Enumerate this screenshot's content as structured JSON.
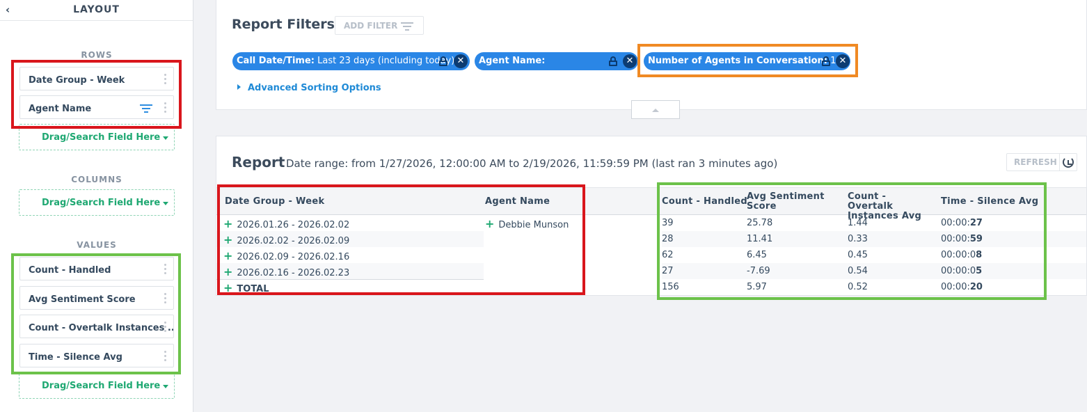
{
  "sidebar": {
    "title": "LAYOUT",
    "rows_label": "ROWS",
    "rows": [
      "Date Group - Week",
      "Agent Name"
    ],
    "columns_label": "COLUMNS",
    "values_label": "VALUES",
    "values": [
      "Count - Handled",
      "Avg Sentiment Score",
      "Count - Overtalk Instances ...",
      "Time - Silence Avg"
    ],
    "drop_label": "Drag/Search Field Here"
  },
  "filters": {
    "title": "Report Filters",
    "add_filter": "ADD FILTER",
    "chips": [
      {
        "label": "Call Date/Time:",
        "value": " Last 23 days (including today)"
      },
      {
        "label": "Agent Name:",
        "value": ""
      },
      {
        "label": "Number of Agents in Conversation:",
        "value": " 1"
      }
    ],
    "advanced": "Advanced Sorting Options"
  },
  "report": {
    "title": "Report",
    "range": "Date range: from 1/27/2026, 12:00:00 AM to 2/19/2026, 11:59:59 PM (last ran 3 minutes ago)",
    "refresh": "REFRESH",
    "headers": {
      "date_group": "Date Group - Week",
      "agent": "Agent Name",
      "count_handled": "Count - Handled",
      "avg_sentiment": "Avg Sentiment Score",
      "overtalk": "Count - Overtalk Instances Avg",
      "silence": "Time - Silence Avg"
    },
    "agent": "Debbie Munson",
    "rows": [
      {
        "week": "2026.01.26 - 2026.02.02",
        "count": "39",
        "sentiment": "25.78",
        "overtalk": "1.44",
        "silence_pre": "00:00:",
        "silence_bold": "27"
      },
      {
        "week": "2026.02.02 - 2026.02.09",
        "count": "28",
        "sentiment": "11.41",
        "overtalk": "0.33",
        "silence_pre": "00:00:",
        "silence_bold": "59"
      },
      {
        "week": "2026.02.09 - 2026.02.16",
        "count": "62",
        "sentiment": "6.45",
        "overtalk": "0.45",
        "silence_pre": "00:00:0",
        "silence_bold": "8"
      },
      {
        "week": "2026.02.16 - 2026.02.23",
        "count": "27",
        "sentiment": "-7.69",
        "overtalk": "0.54",
        "silence_pre": "00:00:0",
        "silence_bold": "5"
      }
    ],
    "total": {
      "label": "TOTAL",
      "count": "156",
      "sentiment": "5.97",
      "overtalk": "0.52",
      "silence_pre": "00:00:",
      "silence_bold": "20"
    }
  },
  "colors": {
    "highlight_red": "#d9161c",
    "highlight_green": "#6cc24a",
    "highlight_orange": "#f08a24",
    "chip_blue": "#2a86e6",
    "accent_green": "#1fa872"
  }
}
